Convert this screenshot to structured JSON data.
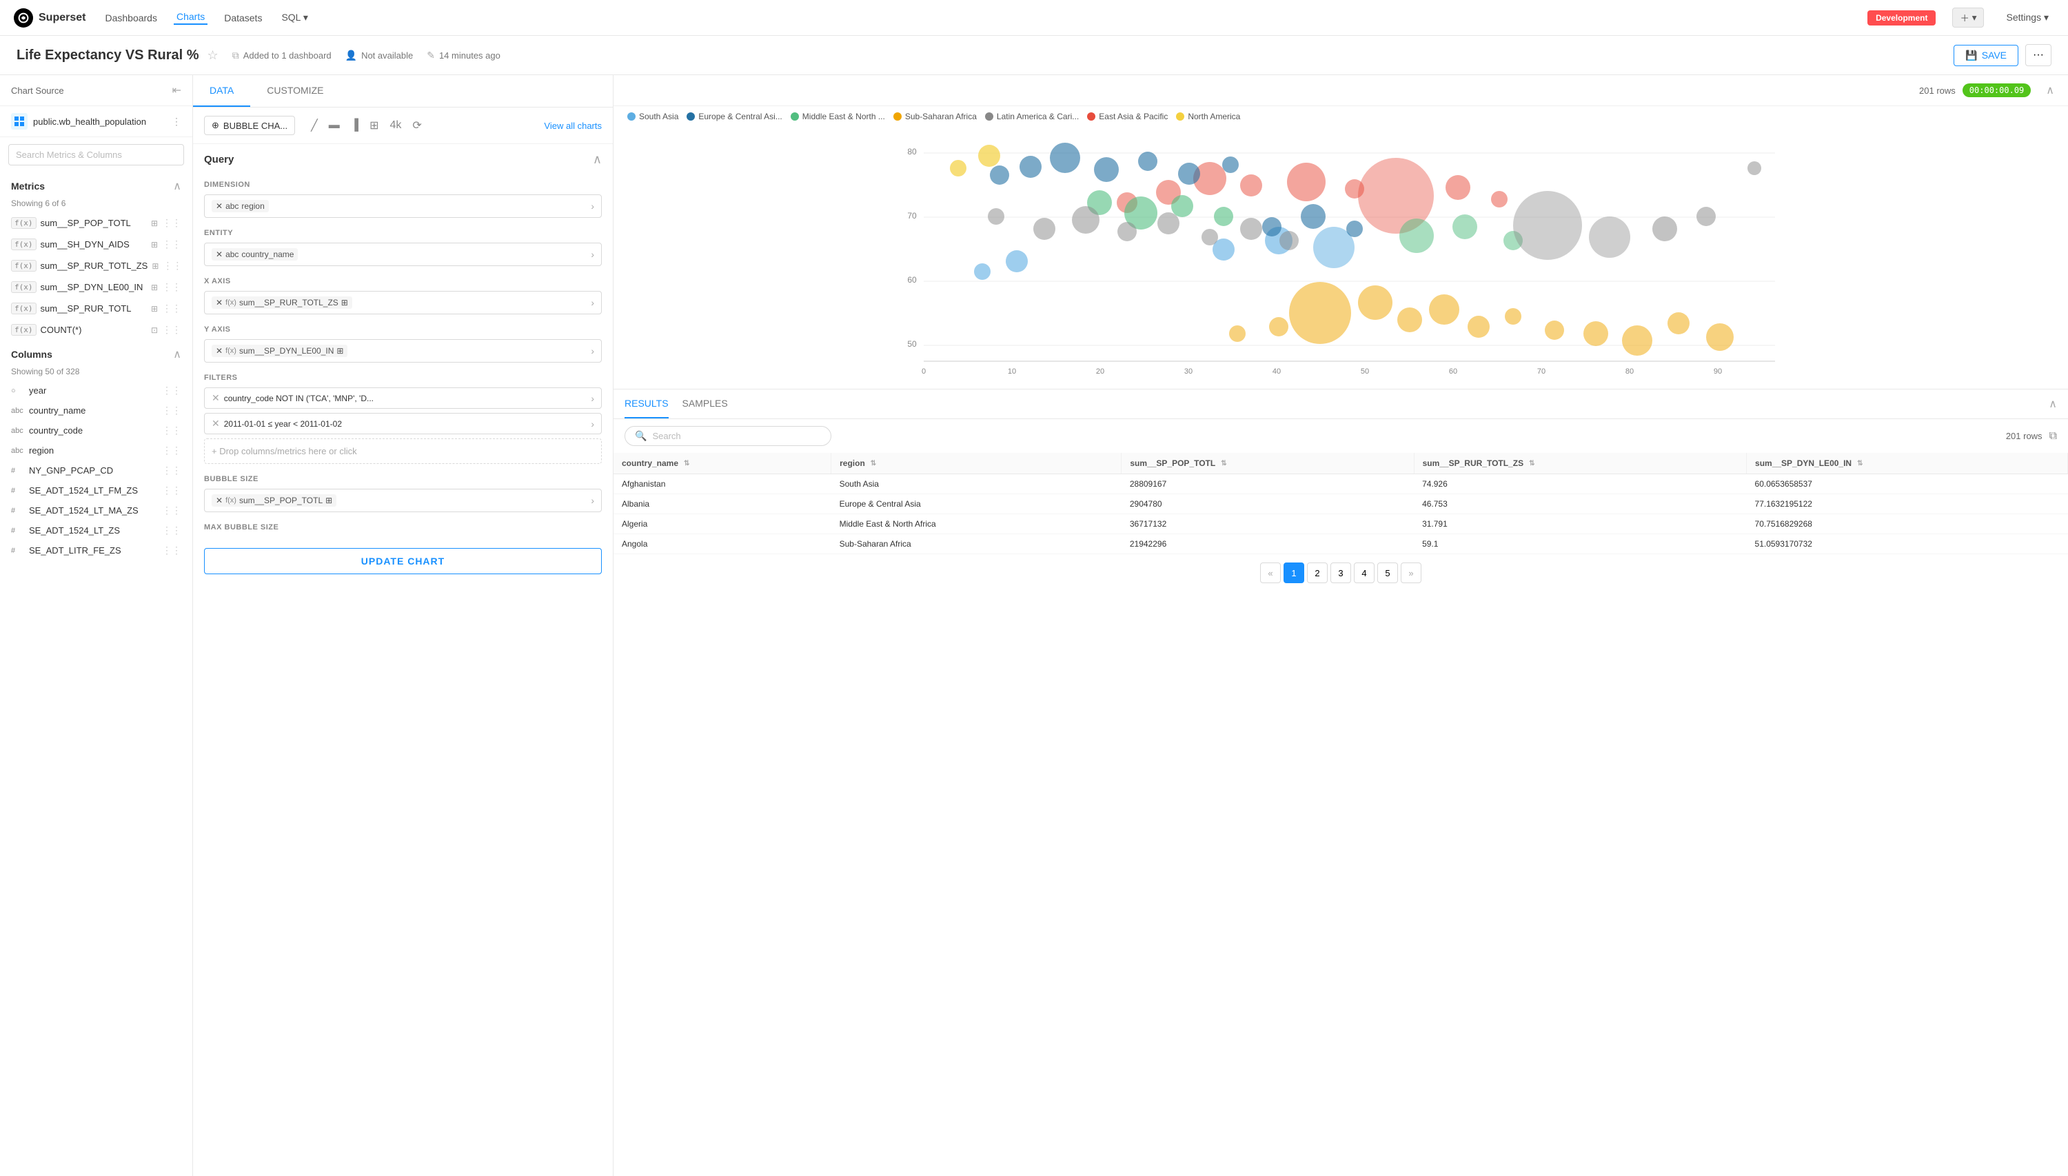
{
  "app": {
    "logo_text": "Superset",
    "nav": {
      "dashboards": "Dashboards",
      "charts": "Charts",
      "datasets": "Datasets",
      "sql": "SQL ▾",
      "env_badge": "Development",
      "settings": "Settings ▾"
    }
  },
  "chart_header": {
    "title": "Life Expectancy VS Rural %",
    "meta": {
      "dashboard": "Added to 1 dashboard",
      "availability": "Not available",
      "time_ago": "14 minutes ago"
    },
    "actions": {
      "save": "SAVE",
      "more": "···"
    }
  },
  "sidebar": {
    "source_label": "Chart Source",
    "source_name": "public.wb_health_population",
    "search_placeholder": "Search Metrics & Columns",
    "metrics_section": {
      "title": "Metrics",
      "count": "Showing 6 of 6",
      "items": [
        {
          "name": "sum__SP_POP_TOTL",
          "has_info": true
        },
        {
          "name": "sum__SH_DYN_AIDS",
          "has_info": true
        },
        {
          "name": "sum__SP_RUR_TOTL_ZS",
          "has_info": true
        },
        {
          "name": "sum__SP_DYN_LE00_IN",
          "has_info": true
        },
        {
          "name": "sum__SP_RUR_TOTL",
          "has_info": true
        },
        {
          "name": "COUNT(*)",
          "has_info": true
        }
      ]
    },
    "columns_section": {
      "title": "Columns",
      "count": "Showing 50 of 328",
      "items": [
        {
          "type": "○",
          "name": "year"
        },
        {
          "type": "abc",
          "name": "country_name"
        },
        {
          "type": "abc",
          "name": "country_code"
        },
        {
          "type": "abc",
          "name": "region"
        },
        {
          "type": "#",
          "name": "NY_GNP_PCAP_CD"
        },
        {
          "type": "#",
          "name": "SE_ADT_1524_LT_FM_ZS"
        },
        {
          "type": "#",
          "name": "SE_ADT_1524_LT_MA_ZS"
        },
        {
          "type": "#",
          "name": "SE_ADT_1524_LT_ZS"
        },
        {
          "type": "#",
          "name": "SE_ADT_LITR_FE_ZS"
        }
      ]
    }
  },
  "middle_panel": {
    "tabs": {
      "data": "DATA",
      "customize": "CUSTOMIZE"
    },
    "chart_type": "BUBBLE CHA...",
    "view_all": "View all charts",
    "query": {
      "title": "Query",
      "dimension_label": "DIMENSION",
      "dimension_value": "region",
      "entity_label": "ENTITY",
      "entity_value": "country_name",
      "xaxis_label": "X AXIS",
      "xaxis_value": "sum__SP_RUR_TOTL_ZS",
      "yaxis_label": "Y AXIS",
      "yaxis_value": "sum__SP_DYN_LE00_IN",
      "filters_label": "FILTERS",
      "filter1": "country_code NOT IN ('TCA', 'MNP', 'D...",
      "filter2": "2011-01-01 ≤ year < 2011-01-02",
      "drop_placeholder": "+ Drop columns/metrics here or click",
      "bubble_size_label": "BUBBLE SIZE",
      "bubble_size_value": "sum__SP_POP_TOTL",
      "max_bubble_label": "MAX BUBBLE SIZE",
      "update_btn": "UPDATE CHART"
    }
  },
  "chart": {
    "rows_count": "201 rows",
    "timer": "00:00:00.09",
    "legend": [
      {
        "label": "South Asia",
        "color": "#5DADE2"
      },
      {
        "label": "Europe & Central Asi...",
        "color": "#2471A3"
      },
      {
        "label": "Middle East & North ...",
        "color": "#52BE80"
      },
      {
        "label": "Sub-Saharan Africa",
        "color": "#F0A500"
      },
      {
        "label": "Latin America & Cari...",
        "color": "#808080"
      },
      {
        "label": "East Asia & Pacific",
        "color": "#E74C3C"
      },
      {
        "label": "North America",
        "color": "#F4D03F"
      }
    ],
    "x_axis_labels": [
      "0",
      "10",
      "20",
      "30",
      "40",
      "50",
      "60",
      "70",
      "80",
      "90"
    ],
    "y_axis_labels": [
      "80",
      "70",
      "60",
      "50"
    ]
  },
  "results": {
    "tabs": [
      "RESULTS",
      "SAMPLES"
    ],
    "search_placeholder": "Search",
    "rows_count": "201 rows",
    "columns": [
      {
        "key": "country_name",
        "label": "country_name"
      },
      {
        "key": "region",
        "label": "region"
      },
      {
        "key": "sum_SP_POP_TOTL",
        "label": "sum__SP_POP_TOTL"
      },
      {
        "key": "sum_SP_RUR_TOTL_ZS",
        "label": "sum__SP_RUR_TOTL_ZS"
      },
      {
        "key": "sum_SP_DYN_LE00_IN",
        "label": "sum__SP_DYN_LE00_IN"
      }
    ],
    "rows": [
      {
        "country_name": "Afghanistan",
        "region": "South Asia",
        "sum_SP_POP_TOTL": "28809167",
        "sum_SP_RUR_TOTL_ZS": "74.926",
        "sum_SP_DYN_LE00_IN": "60.0653658537"
      },
      {
        "country_name": "Albania",
        "region": "Europe & Central Asia",
        "sum_SP_POP_TOTL": "2904780",
        "sum_SP_RUR_TOTL_ZS": "46.753",
        "sum_SP_DYN_LE00_IN": "77.1632195122"
      },
      {
        "country_name": "Algeria",
        "region": "Middle East & North Africa",
        "sum_SP_POP_TOTL": "36717132",
        "sum_SP_RUR_TOTL_ZS": "31.791",
        "sum_SP_DYN_LE00_IN": "70.7516829268"
      },
      {
        "country_name": "Angola",
        "region": "Sub-Saharan Africa",
        "sum_SP_POP_TOTL": "21942296",
        "sum_SP_RUR_TOTL_ZS": "59.1",
        "sum_SP_DYN_LE00_IN": "51.0593170732"
      }
    ],
    "pagination": {
      "prev": "«",
      "pages": [
        "1",
        "2",
        "3",
        "4",
        "5"
      ],
      "next": "»",
      "active_page": "1"
    }
  }
}
